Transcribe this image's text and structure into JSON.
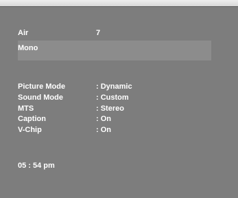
{
  "channel": {
    "source": "Air",
    "number": "7",
    "audio": "Mono"
  },
  "settings": [
    {
      "name": "Picture Mode",
      "value": ": Dynamic"
    },
    {
      "name": "Sound Mode",
      "value": ": Custom"
    },
    {
      "name": "MTS",
      "value": ": Stereo"
    },
    {
      "name": "Caption",
      "value": ": On"
    },
    {
      "name": "V-Chip",
      "value": ": On"
    }
  ],
  "clock": "05 : 54 pm",
  "colors": {
    "screen_background": "#7d7d7d",
    "highlight_row": "#8c8c8c",
    "text": "#ffffff"
  }
}
